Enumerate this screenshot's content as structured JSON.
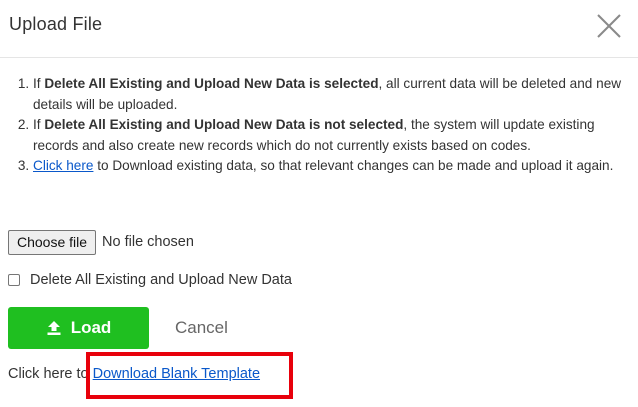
{
  "modal": {
    "title": "Upload File",
    "close_icon": "close-icon"
  },
  "instructions": [
    {
      "prefix": "If ",
      "bold": "Delete All Existing and Upload New Data is selected",
      "suffix": ", all current data will be deleted and new details will be uploaded."
    },
    {
      "prefix": "If ",
      "bold": "Delete All Existing and Upload New Data is not selected",
      "suffix": ", the system will update existing records and also create new records which do not currently exists based on codes."
    },
    {
      "link": "Click here",
      "suffix": " to Download existing data, so that relevant changes can be made and upload it again."
    }
  ],
  "file_input": {
    "button_label": "Choose file",
    "status": "No file chosen"
  },
  "checkbox": {
    "label": "Delete All Existing and Upload New Data",
    "checked": false
  },
  "actions": {
    "load_label": "Load",
    "load_icon": "upload-icon",
    "cancel_label": "Cancel",
    "load_color": "#1fbf20"
  },
  "template": {
    "prefix": "Click here to",
    "link": "Download Blank Template"
  },
  "colors": {
    "link": "#0a58ca",
    "highlight": "#e8000b"
  }
}
